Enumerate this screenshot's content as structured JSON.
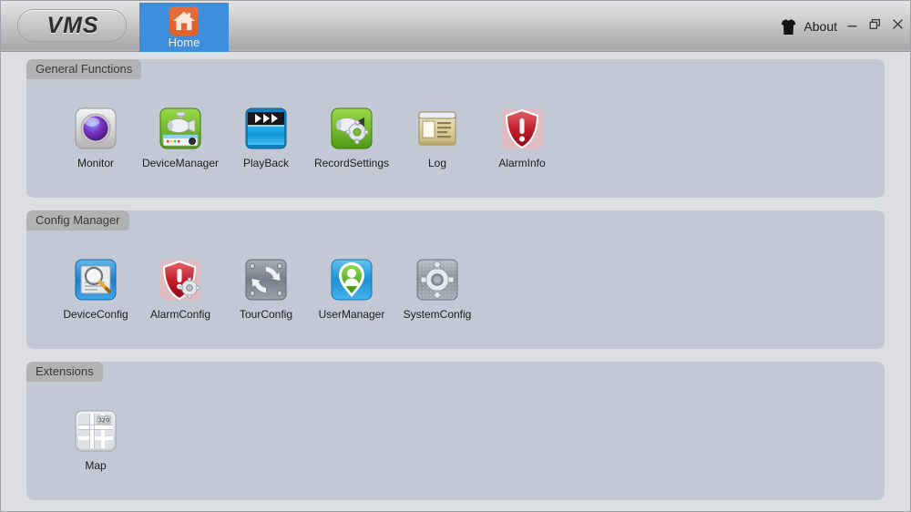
{
  "window": {
    "logo": "VMS",
    "about_label": "About",
    "about_icon": "about-shirt-icon",
    "controls": [
      {
        "name": "minimize-button",
        "glyph": "minimize-icon"
      },
      {
        "name": "restore-button",
        "glyph": "restore-icon"
      },
      {
        "name": "close-button",
        "glyph": "close-icon"
      }
    ]
  },
  "tabs": [
    {
      "label": "Home",
      "icon": "home-icon",
      "active": true
    }
  ],
  "colors": {
    "accent": "#3e8ede",
    "titlebar_top": "#e4e4e4",
    "titlebar_bottom": "#a8a8a8",
    "window_bg": "#dcdee1",
    "panel_bg": "#c3c9d4",
    "panel_header_bg": "#b0b2b4",
    "label_text": "#1c1c1c",
    "home_icon_bg": "#e0622c"
  },
  "sections": [
    {
      "title": "General Functions",
      "items": [
        {
          "label": "Monitor",
          "icon": "monitor-lens-icon"
        },
        {
          "label": "DeviceManager",
          "icon": "device-manager-camera-icon"
        },
        {
          "label": "PlayBack",
          "icon": "playback-clapperboard-icon"
        },
        {
          "label": "RecordSettings",
          "icon": "record-settings-camera-gear-icon"
        },
        {
          "label": "Log",
          "icon": "log-document-window-icon"
        },
        {
          "label": "AlarmInfo",
          "icon": "alarm-info-shield-icon"
        }
      ]
    },
    {
      "title": "Config Manager",
      "items": [
        {
          "label": "DeviceConfig",
          "icon": "device-config-magnifier-icon"
        },
        {
          "label": "AlarmConfig",
          "icon": "alarm-config-shield-gear-icon"
        },
        {
          "label": "TourConfig",
          "icon": "tour-config-refresh-icon"
        },
        {
          "label": "UserManager",
          "icon": "user-manager-pin-icon"
        },
        {
          "label": "SystemConfig",
          "icon": "system-config-gear-icon"
        }
      ]
    },
    {
      "title": "Extensions",
      "items": [
        {
          "label": "Map",
          "icon": "map-streets-icon",
          "badge": "320"
        }
      ]
    }
  ]
}
